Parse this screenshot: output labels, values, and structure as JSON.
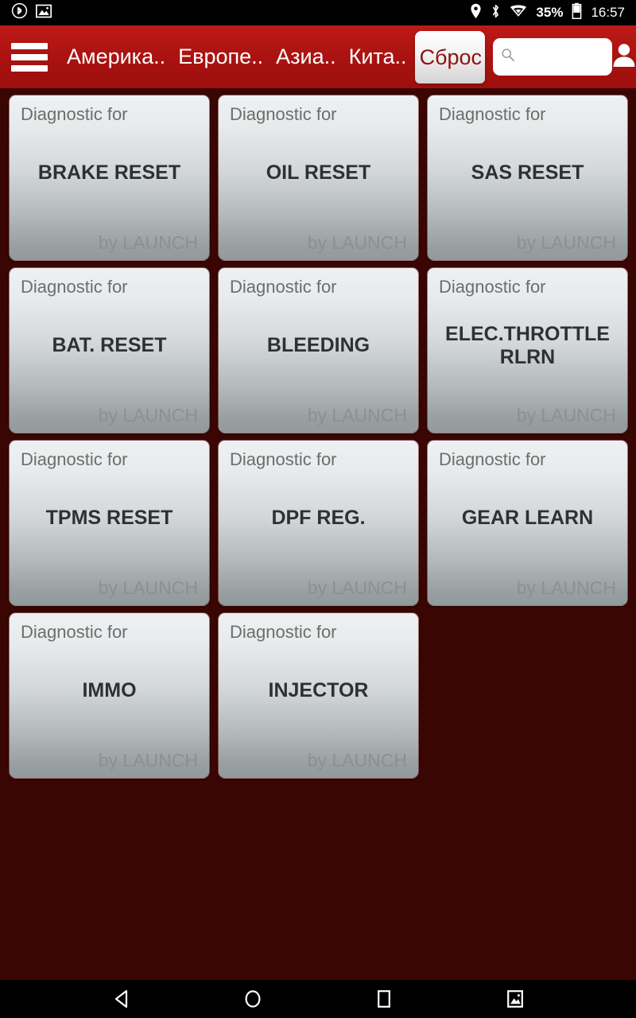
{
  "status_bar": {
    "left_icons": [
      "bluetooth-circle-icon",
      "screenshot-icon"
    ],
    "right_icons": [
      "location-pin-icon",
      "bluetooth-icon",
      "wifi-icon"
    ],
    "battery_percent": "35%",
    "battery_icon": "battery-icon",
    "clock": "16:57"
  },
  "header": {
    "menu_icon": "hamburger-menu-icon",
    "tabs": [
      {
        "label": "Америка..",
        "active": false
      },
      {
        "label": "Европе..",
        "active": false
      },
      {
        "label": "Азиа..",
        "active": false
      },
      {
        "label": "Кита..",
        "active": false
      },
      {
        "label": "Сброс",
        "active": true
      }
    ],
    "search": {
      "icon": "search-icon",
      "value": "",
      "placeholder": ""
    },
    "profile_icon": "user-avatar-icon",
    "colors": {
      "bar": "#a81210",
      "active_tab_text": "#8d1210"
    }
  },
  "main": {
    "background_color": "#3a0604",
    "card_kicker": "Diagnostic for",
    "card_vendor": "by LAUNCH",
    "cards": [
      {
        "kicker": "Diagnostic for",
        "title": "BRAKE RESET",
        "vendor": "by LAUNCH"
      },
      {
        "kicker": "Diagnostic for",
        "title": "OIL RESET",
        "vendor": "by LAUNCH"
      },
      {
        "kicker": "Diagnostic for",
        "title": "SAS RESET",
        "vendor": "by LAUNCH"
      },
      {
        "kicker": "Diagnostic for",
        "title": "BAT. RESET",
        "vendor": "by LAUNCH"
      },
      {
        "kicker": "Diagnostic for",
        "title": "BLEEDING",
        "vendor": "by LAUNCH"
      },
      {
        "kicker": "Diagnostic for",
        "title": "ELEC.THROTTLE\nRLRN",
        "vendor": "by LAUNCH"
      },
      {
        "kicker": "Diagnostic for",
        "title": "TPMS RESET",
        "vendor": "by LAUNCH"
      },
      {
        "kicker": "Diagnostic for",
        "title": "DPF REG.",
        "vendor": "by LAUNCH"
      },
      {
        "kicker": "Diagnostic for",
        "title": "GEAR LEARN",
        "vendor": "by LAUNCH"
      },
      {
        "kicker": "Diagnostic for",
        "title": "IMMO",
        "vendor": "by LAUNCH"
      },
      {
        "kicker": "Diagnostic for",
        "title": "INJECTOR",
        "vendor": "by LAUNCH"
      }
    ]
  },
  "nav_bar": {
    "buttons": [
      "back-icon",
      "home-icon",
      "recents-icon",
      "screenshot-icon"
    ]
  }
}
